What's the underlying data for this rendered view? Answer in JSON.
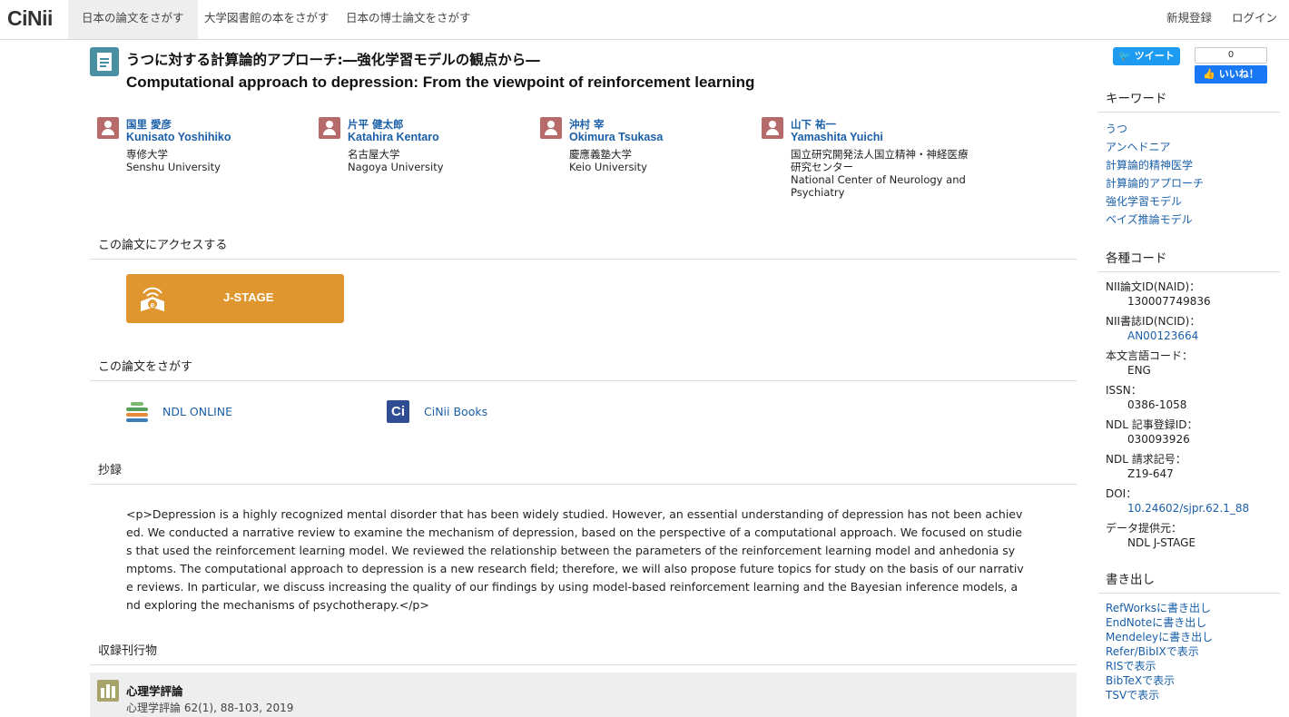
{
  "header": {
    "logo": "CiNii",
    "tabs": [
      {
        "label": "日本の論文をさがす"
      },
      {
        "label": "大学図書館の本をさがす"
      },
      {
        "label": "日本の博士論文をさがす"
      }
    ],
    "register": "新規登録",
    "login": "ログイン"
  },
  "article": {
    "title_ja": "うつに対する計算論的アプローチ:―強化学習モデルの観点から―",
    "title_en": "Computational approach to depression: From the viewpoint of reinforcement learning"
  },
  "authors": [
    {
      "jp": "国里 愛彦",
      "romaji": "Kunisato Yoshihiko",
      "aff_ja": "専修大学",
      "aff_en": "Senshu University"
    },
    {
      "jp": "片平 健太郎",
      "romaji": "Katahira Kentaro",
      "aff_ja": "名古屋大学",
      "aff_en": "Nagoya University"
    },
    {
      "jp": "沖村 宰",
      "romaji": "Okimura Tsukasa",
      "aff_ja": "慶應義塾大学",
      "aff_en": "Keio University"
    },
    {
      "jp": "山下 祐一",
      "romaji": "Yamashita Yuichi",
      "aff_ja": "国立研究開発法人国立精神・神経医療研究センター",
      "aff_en": "National Center of Neurology and Psychiatry"
    }
  ],
  "access": {
    "heading": "この論文にアクセスする",
    "jstage_label": "J-STAGE"
  },
  "search": {
    "heading": "この論文をさがす",
    "ndl": "NDL ONLINE",
    "cinii_books": "CiNii Books"
  },
  "abstract": {
    "heading": "抄録",
    "text": "<p>Depression is a highly recognized mental disorder that has been widely studied. However, an essential understanding of depression has not been achieved. We conducted a narrative review to examine the mechanism of depression, based on the perspective of a computational approach. We focused on studies that used the reinforcement learning model. We reviewed the relationship between the parameters of the reinforcement learning model and anhedonia symptoms. The computational approach to depression is a new research field; therefore, we will also propose future topics for study on the basis of our narrative reviews. In particular, we discuss increasing the quality of our findings by using model-based reinforcement learning and the Bayesian inference models, and exploring the mechanisms of psychotherapy.</p>"
  },
  "journal": {
    "heading": "収録刊行物",
    "title": "心理学評論",
    "info": "心理学評論 62(1), 88-103, 2019"
  },
  "social": {
    "tweet": "ツイート",
    "fb_count": "0",
    "fb_like": "いいね！"
  },
  "sidebar": {
    "keywords_heading": "キーワード",
    "keywords": [
      "うつ",
      "アンヘドニア",
      "計算論的精神医学",
      "計算論的アプローチ",
      "強化学習モデル",
      "ベイズ推論モデル"
    ],
    "codes_heading": "各種コード",
    "codes": [
      {
        "key": "NII論文ID(NAID)：",
        "value": "130007749836"
      },
      {
        "key": "NII書誌ID(NCID)：",
        "value": "AN00123664"
      },
      {
        "key": "本文言語コード：",
        "value": "ENG"
      },
      {
        "key": "ISSN：",
        "value": "0386-1058"
      },
      {
        "key": "NDL 記事登録ID：",
        "value": "030093926"
      },
      {
        "key": "NDL 請求記号：",
        "value": "Z19-647"
      },
      {
        "key": "DOI：",
        "value": "10.24602/sjpr.62.1_88"
      },
      {
        "key": "データ提供元：",
        "value": "NDL  J-STAGE"
      }
    ],
    "export_heading": "書き出し",
    "exports": [
      "RefWorksに書き出し",
      "EndNoteに書き出し",
      "Mendeleyに書き出し",
      "Refer/BibIXで表示",
      "RISで表示",
      "BibTeXで表示",
      "TSVで表示"
    ]
  },
  "colors": {
    "link": "#1a5fa8",
    "jstage": "#e0962e",
    "doc_icon": "#4a8ea1",
    "author_icon": "#b76a6a",
    "tweet": "#1d9bf0",
    "facebook": "#1877f2"
  }
}
